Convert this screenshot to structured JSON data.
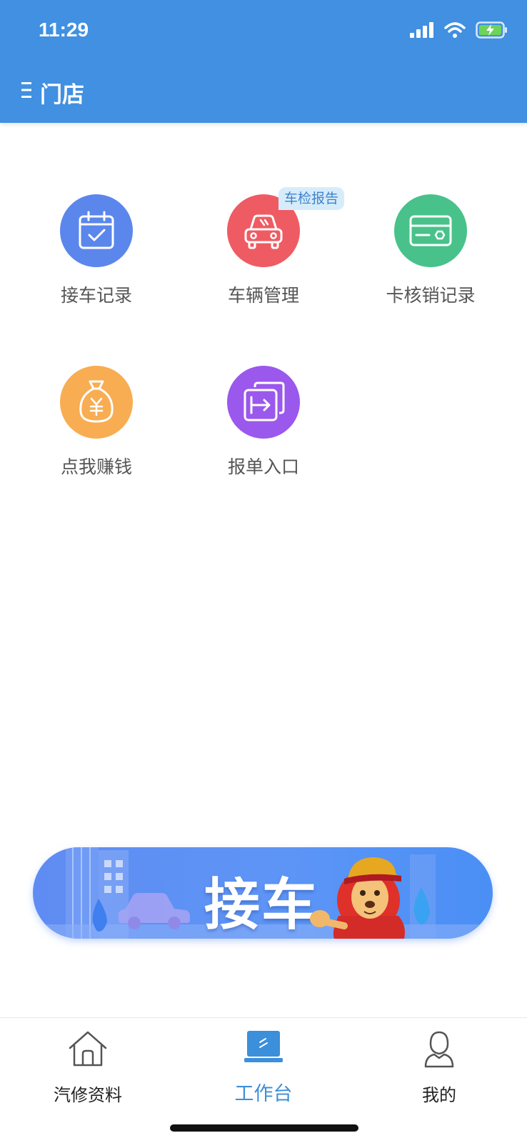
{
  "status_bar": {
    "time": "11:29"
  },
  "header": {
    "title": "门店"
  },
  "grid": [
    {
      "label": "接车记录",
      "icon": "calendar-check-icon",
      "color": "#5b86ec"
    },
    {
      "label": "车辆管理",
      "icon": "car-icon",
      "color": "#ef5b62",
      "badge": "车检报告"
    },
    {
      "label": "卡核销记录",
      "icon": "card-icon",
      "color": "#48c28a"
    },
    {
      "label": "点我赚钱",
      "icon": "money-bag-icon",
      "color": "#f8ad52"
    },
    {
      "label": "报单入口",
      "icon": "entry-icon",
      "color": "#9b58ec"
    }
  ],
  "banner": {
    "text": "接车"
  },
  "tabbar": {
    "items": [
      {
        "label": "汽修资料",
        "icon": "home-icon"
      },
      {
        "label": "工作台",
        "icon": "workbench-icon",
        "active": true
      },
      {
        "label": "我的",
        "icon": "person-icon"
      }
    ]
  },
  "colors": {
    "brand": "#4190e1",
    "active_tab": "#3c8fda"
  }
}
